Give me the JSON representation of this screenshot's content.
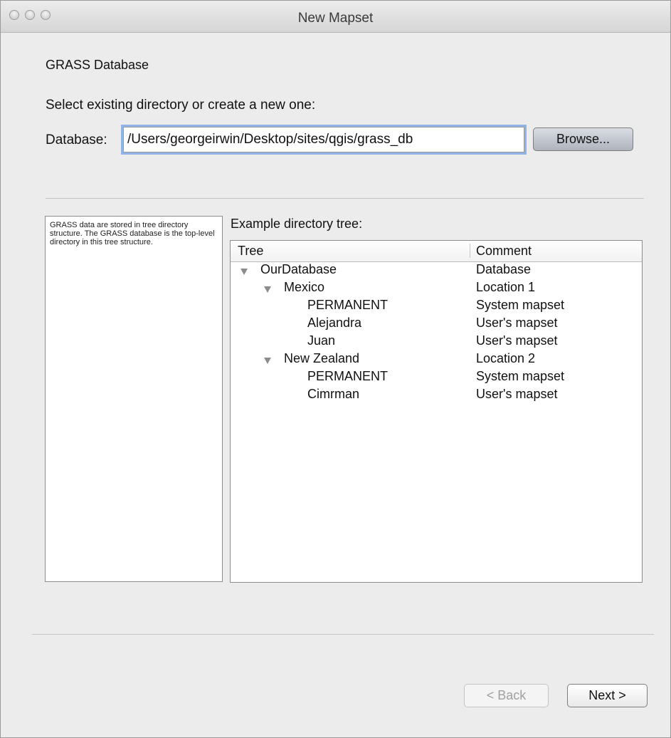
{
  "window": {
    "title": "New Mapset"
  },
  "section": {
    "title": "GRASS Database",
    "instruction": "Select existing directory or create a new one:"
  },
  "database": {
    "label": "Database:",
    "value": "/Users/georgeirwin/Desktop/sites/qgis/grass_db",
    "browse_label": "Browse..."
  },
  "info_text": "GRASS data are stored in tree directory structure. The GRASS database is the top-level directory in this tree structure.",
  "example": {
    "label": "Example directory tree:",
    "columns": [
      "Tree",
      "Comment"
    ],
    "rows": [
      {
        "name": "OurDatabase",
        "comment": "Database",
        "level": 0,
        "expanded": true
      },
      {
        "name": "Mexico",
        "comment": "Location 1",
        "level": 1,
        "expanded": true
      },
      {
        "name": "PERMANENT",
        "comment": "System mapset",
        "level": 2,
        "expanded": false
      },
      {
        "name": "Alejandra",
        "comment": "User's mapset",
        "level": 2,
        "expanded": false
      },
      {
        "name": "Juan",
        "comment": "User's mapset",
        "level": 2,
        "expanded": false
      },
      {
        "name": "New Zealand",
        "comment": "Location 2",
        "level": 1,
        "expanded": true
      },
      {
        "name": "PERMANENT",
        "comment": "System mapset",
        "level": 2,
        "expanded": false
      },
      {
        "name": "Cimrman",
        "comment": "User's mapset",
        "level": 2,
        "expanded": false
      }
    ]
  },
  "footer": {
    "back_label": "< Back",
    "back_enabled": false,
    "next_label": "Next >"
  },
  "colors": {
    "window_bg": "#ececec",
    "focus_ring": "#8fb2e8",
    "browse_button": "#c2c7cf"
  }
}
